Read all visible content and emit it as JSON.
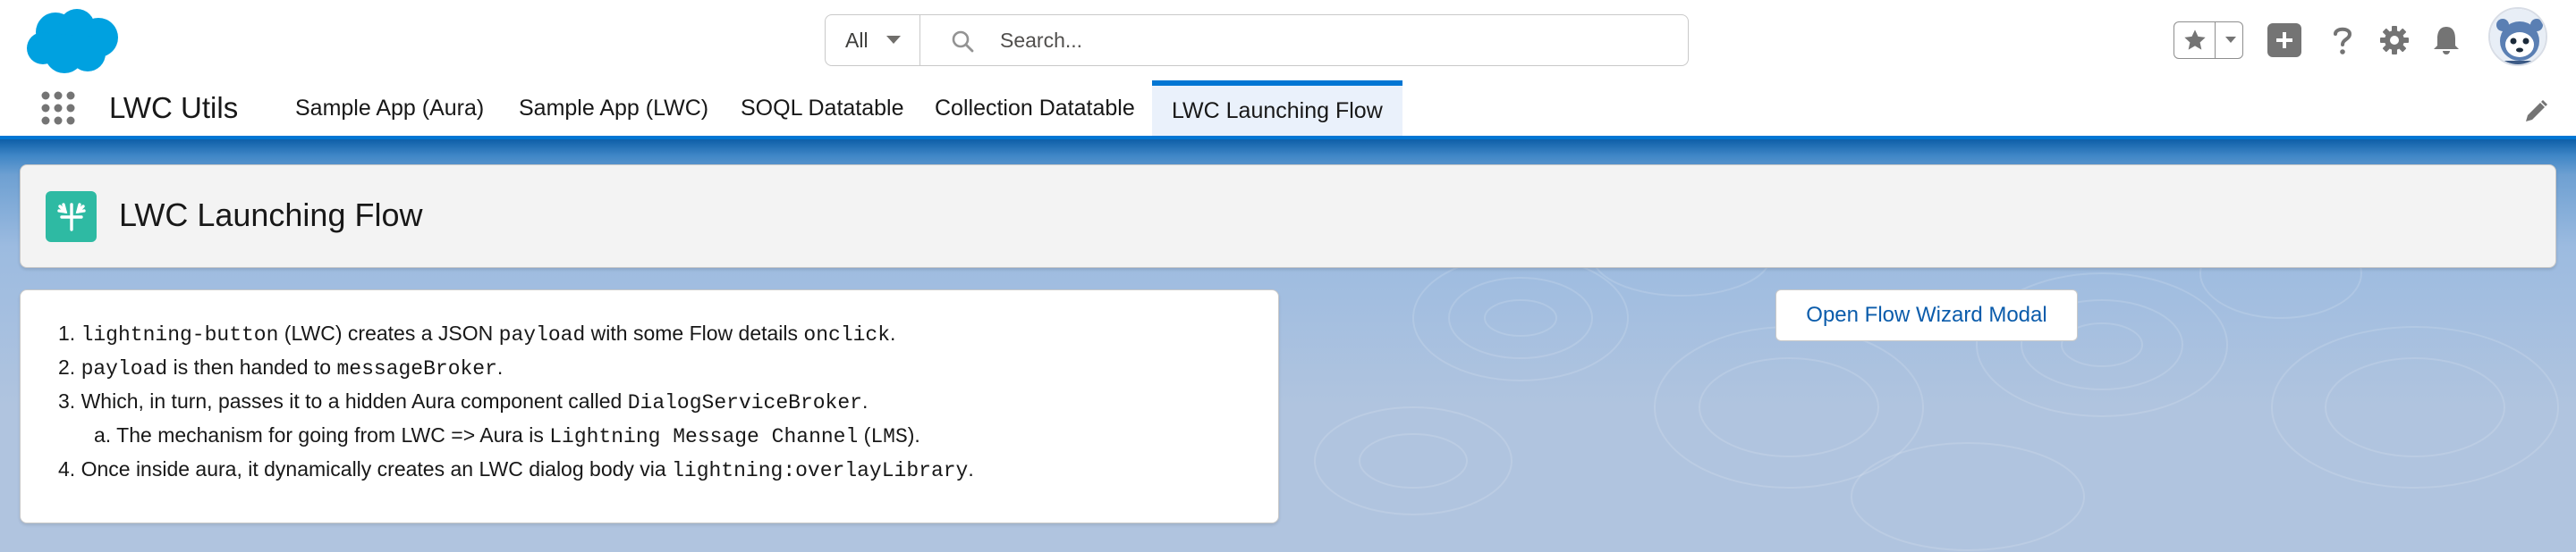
{
  "global_header": {
    "search": {
      "scope": "All",
      "placeholder": "Search..."
    }
  },
  "nav": {
    "app_name": "LWC Utils",
    "tabs": [
      {
        "label": "Sample App (Aura)",
        "active": false
      },
      {
        "label": "Sample App (LWC)",
        "active": false
      },
      {
        "label": "SOQL Datatable",
        "active": false
      },
      {
        "label": "Collection Datatable",
        "active": false
      },
      {
        "label": "LWC Launching Flow",
        "active": true
      }
    ]
  },
  "page_header": {
    "title": "LWC Launching Flow",
    "icon": "flow-icon"
  },
  "steps": [
    {
      "num": "1.",
      "parts": [
        "",
        "lightning-button",
        " (LWC) creates a JSON ",
        "payload",
        " with some Flow details ",
        "onclick",
        "."
      ]
    },
    {
      "num": "2.",
      "parts": [
        "",
        "payload",
        " is then handed to ",
        "messageBroker",
        "."
      ]
    },
    {
      "num": "3.",
      "parts": [
        "Which, in turn, passes it to a hidden Aura component called ",
        "DialogServiceBroker",
        "."
      ]
    },
    {
      "num": "a.",
      "parts": [
        "The mechanism for going from LWC => Aura is ",
        "Lightning Message Channel",
        " (",
        "LMS",
        ")."
      ]
    },
    {
      "num": "4.",
      "parts": [
        "Once inside aura, it dynamically creates an LWC dialog body via ",
        "lightning:overlayLibrary",
        "."
      ]
    }
  ],
  "action_button": {
    "label": "Open Flow Wizard Modal"
  },
  "colors": {
    "brand": "#0176d3",
    "flow_icon_bg": "#2ebaa3",
    "button_text": "#0b5cab"
  }
}
